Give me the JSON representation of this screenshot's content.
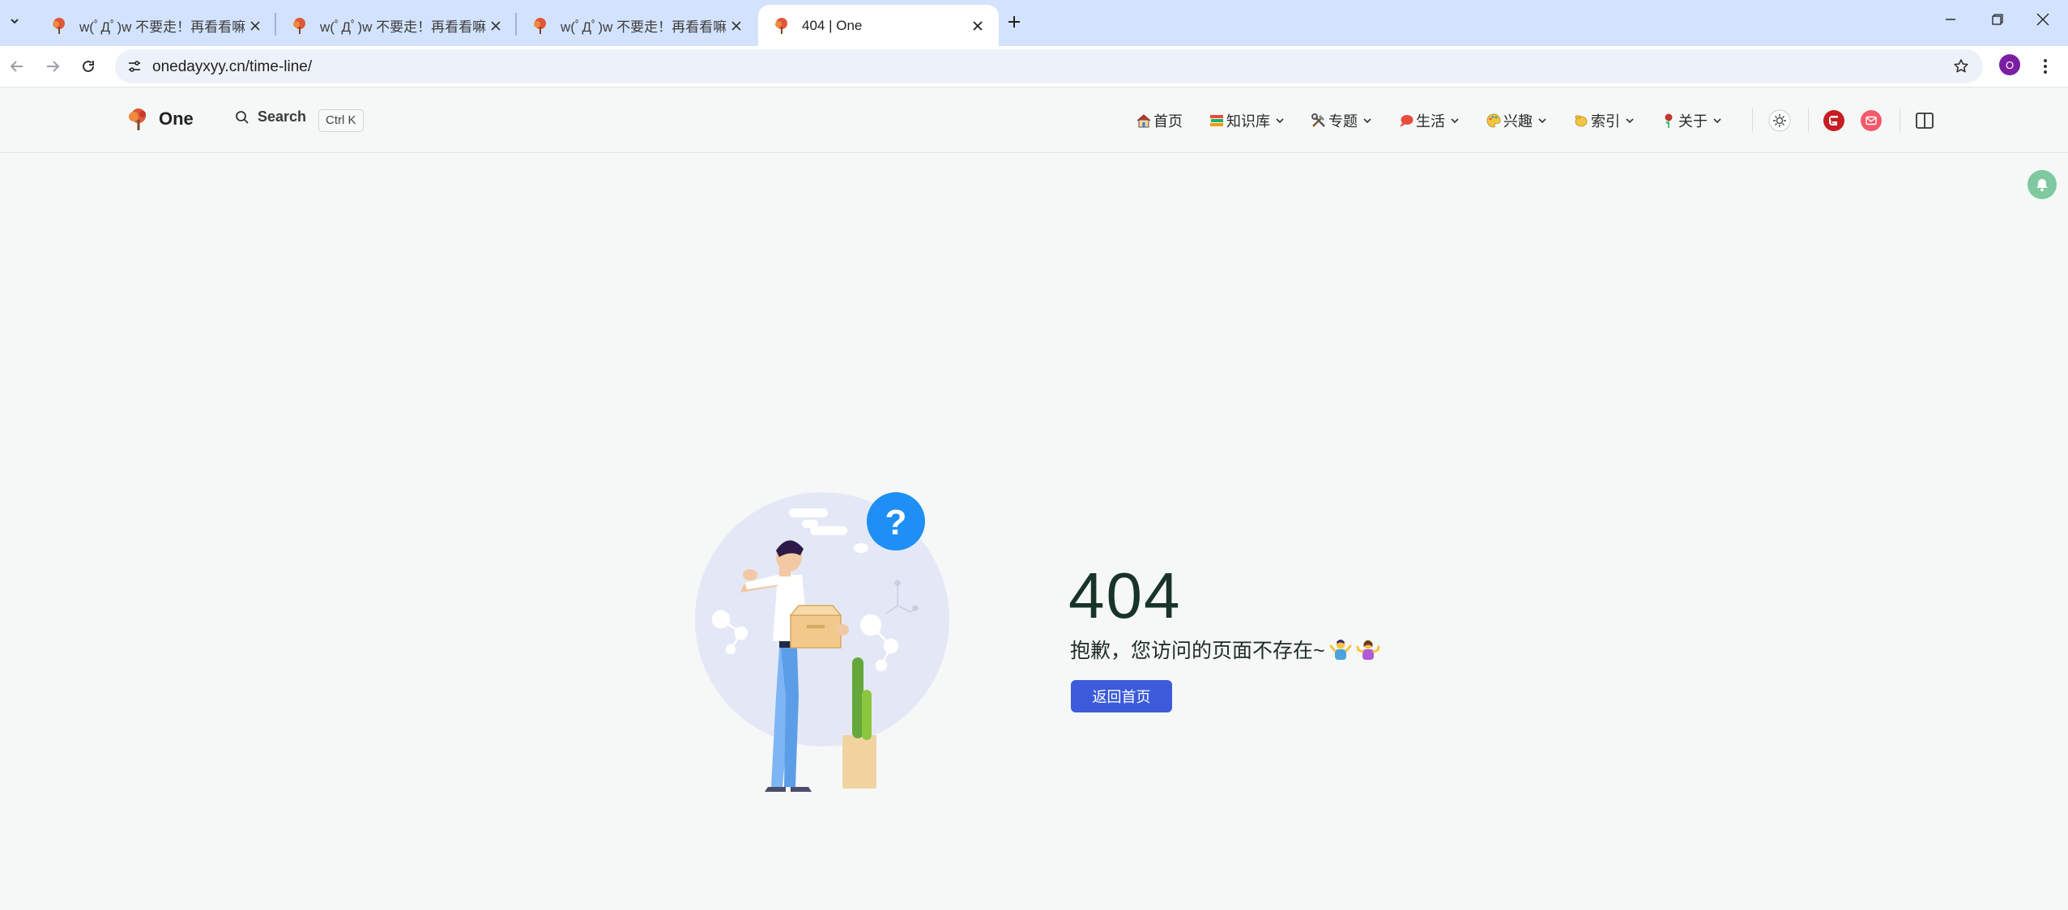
{
  "browser": {
    "tabs": [
      {
        "title": "w(ﾟДﾟ)w 不要走！再看看嘛！",
        "active": false
      },
      {
        "title": "w(ﾟДﾟ)w 不要走！再看看嘛！",
        "active": false
      },
      {
        "title": "w(ﾟДﾟ)w 不要走！再看看嘛！",
        "active": false
      },
      {
        "title": "404 | One",
        "active": true
      }
    ],
    "url": "onedayxyy.cn/time-line/",
    "profile_initial": "O"
  },
  "site": {
    "brand": "One",
    "search_label": "Search",
    "search_shortcut": "Ctrl K",
    "nav": [
      {
        "label": "首页",
        "icon": "house-emoji-icon",
        "dropdown": false
      },
      {
        "label": "知识库",
        "icon": "books-emoji-icon",
        "dropdown": true
      },
      {
        "label": "专题",
        "icon": "tools-emoji-icon",
        "dropdown": true
      },
      {
        "label": "生活",
        "icon": "speech-bubble-emoji-icon",
        "dropdown": true
      },
      {
        "label": "兴趣",
        "icon": "palette-emoji-icon",
        "dropdown": true
      },
      {
        "label": "索引",
        "icon": "pointing-hand-emoji-icon",
        "dropdown": true
      },
      {
        "label": "关于",
        "icon": "rose-emoji-icon",
        "dropdown": true
      }
    ]
  },
  "error": {
    "code": "404",
    "message": "抱歉，您访问的页面不存在~",
    "button": "返回首页"
  },
  "colors": {
    "tabbar_bg": "#d3e3fd",
    "page_bg": "#f5f8f7",
    "primary_button": "#3b5bdb",
    "error_code": "#183428",
    "bell_bg": "#7fc8a0"
  }
}
